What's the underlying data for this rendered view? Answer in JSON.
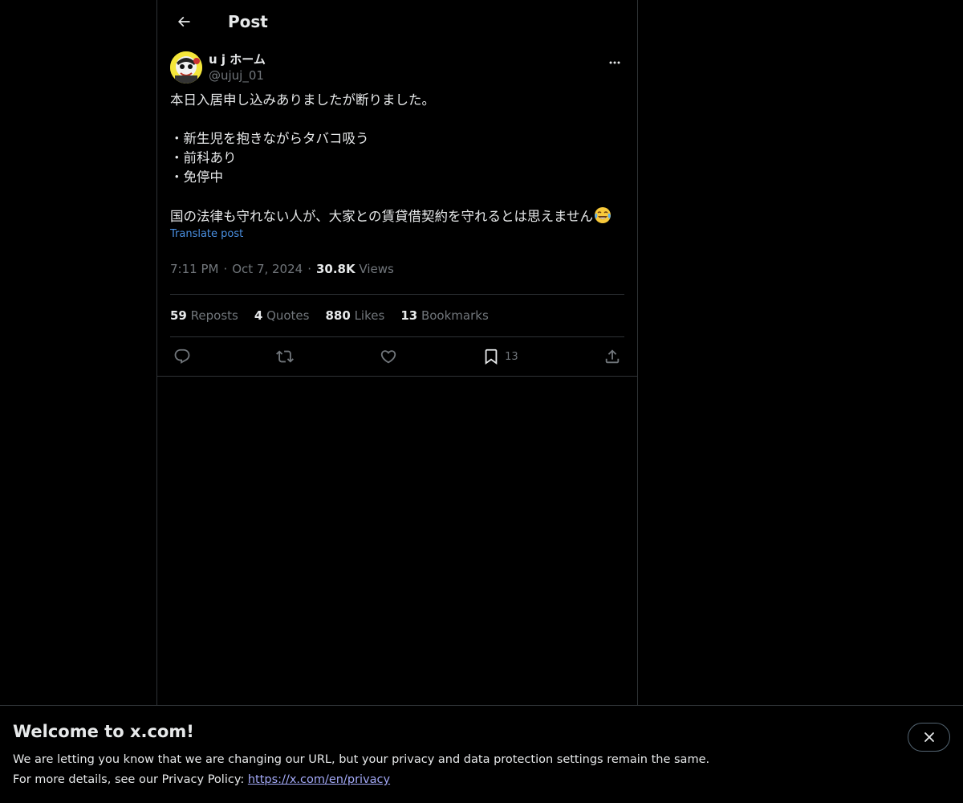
{
  "header": {
    "title": "Post"
  },
  "author": {
    "display_name": "u j ホーム",
    "handle": "@ujuj_01"
  },
  "tweet": {
    "lines": [
      "本日入居申し込みありましたが断りました。",
      "",
      "・新生児を抱きながらタバコ吸う",
      "・前科あり",
      "・免停中",
      "",
      "国の法律も守れない人が、大家との賃貸借契約を守れるとは思えません"
    ],
    "translate_label": "Translate post",
    "time": "7:11 PM",
    "date": "Oct 7, 2024",
    "views_count": "30.8K",
    "views_label": "Views"
  },
  "stats": {
    "reposts_count": "59",
    "reposts_label": "Reposts",
    "quotes_count": "4",
    "quotes_label": "Quotes",
    "likes_count": "880",
    "likes_label": "Likes",
    "bookmarks_count": "13",
    "bookmarks_label": "Bookmarks"
  },
  "actions": {
    "bookmark_count": "13"
  },
  "banner": {
    "title": "Welcome to x.com!",
    "line1": "We are letting you know that we are changing our URL, but your privacy and data protection settings remain the same.",
    "line2_prefix": "For more details, see our Privacy Policy: ",
    "link": "https://x.com/en/privacy"
  },
  "icons": {
    "back": "back-arrow-icon",
    "more": "more-dots-icon",
    "reply": "reply-icon",
    "repost": "repost-icon",
    "like": "like-icon",
    "bookmark": "bookmark-icon",
    "share": "share-icon",
    "close": "close-icon",
    "emoji": "tears-of-joy-emoji"
  },
  "colors": {
    "background": "#000000",
    "text": "#e7e9ea",
    "muted": "#71767b",
    "link": "#4a90e2",
    "border": "#2f3336"
  }
}
